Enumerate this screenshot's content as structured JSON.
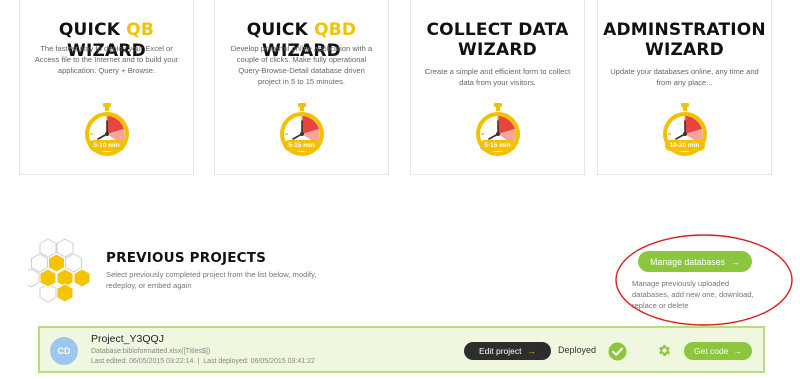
{
  "wizards": [
    {
      "title_pre": "QUICK ",
      "title_hl": "QB",
      "title_post": " WIZARD",
      "title_line2": "",
      "desc": "The fastest way to deploy your Excel or Access file to the Internet and to build your application. Query + Browse.",
      "time": "5-10 min"
    },
    {
      "title_pre": "QUICK ",
      "title_hl": "QBD",
      "title_post": " WIZARD",
      "title_line2": "",
      "desc": "Develop powerful online application with a couple of clicks. Make fully operational Query-Browse-Detail database driven project in 5 to 15 minutes.",
      "time": "5-15 min"
    },
    {
      "title_pre": "COLLECT DATA",
      "title_hl": "",
      "title_post": "",
      "title_line2": "WIZARD",
      "desc": "Create a simple and efficient form to collect data from your visitors.",
      "time": "5-15 min"
    },
    {
      "title_pre": "ADMINSTRATION",
      "title_hl": "",
      "title_post": "",
      "title_line2": "WIZARD",
      "desc": "Update your databases online, any time and from any place...",
      "time": "10-20 min"
    }
  ],
  "previous": {
    "title": "PREVIOUS PROJECTS",
    "desc": "Select previously completed project from the list below, modify, redeploy, or embed again"
  },
  "manage": {
    "label": "Manage databases",
    "arrow": "→",
    "desc": "Manage previously uploaded databases, add new one, download, replace or delete"
  },
  "project": {
    "avatar": "CD",
    "name": "Project_Y3QQJ",
    "database": "Database:bibloformatted.xlsx([Titles$])",
    "last_edited": "Last edited: 06/05/2015 03:22:14",
    "separator": "|",
    "last_deployed": "Last deployed: 06/05/2015 03:41:22",
    "edit_label": "Edit project",
    "edit_arrow": "→",
    "status": "Deployed",
    "getcode_label": "Get code",
    "getcode_arrow": "→"
  },
  "colors": {
    "accent_yellow": "#f2c200",
    "accent_green": "#8cc63f",
    "timer_red": "#e8453c",
    "annotation_red": "#d81e1e"
  },
  "icons": {
    "timer": "timer-icon",
    "hex_logo": "honeycomb-icon",
    "check": "check-circle-icon",
    "gear": "gear-icon",
    "arrow": "arrow-right-icon"
  }
}
